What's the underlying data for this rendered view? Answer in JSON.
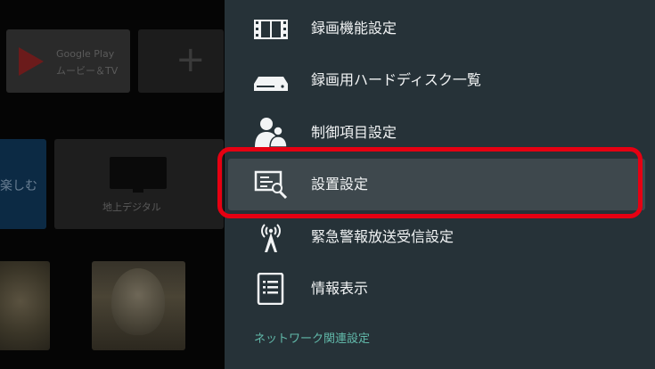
{
  "background_launcher": {
    "tiles": [
      {
        "title_line1": "Google Play",
        "title_line2": "ムービー＆TV"
      },
      {
        "plus": "+"
      },
      {
        "partial_text": "楽しむ"
      },
      {
        "label": "地上デジタル"
      }
    ]
  },
  "settings_panel": {
    "items": [
      {
        "label": "録画機能設定",
        "icon": "film-icon"
      },
      {
        "label": "録画用ハードディスク一覧",
        "icon": "hard-disk-icon"
      },
      {
        "label": "制御項目設定",
        "icon": "users-icon"
      },
      {
        "label": "設置設定",
        "icon": "install-settings-icon",
        "selected": true
      },
      {
        "label": "緊急警報放送受信設定",
        "icon": "broadcast-antenna-icon"
      },
      {
        "label": "情報表示",
        "icon": "document-icon"
      }
    ],
    "section_header": "ネットワーク関連設定"
  },
  "colors": {
    "panel_bg": "#263238",
    "selected_bg": "#3e484d",
    "section_accent": "#61b8a9",
    "annotation_red": "#e60012"
  }
}
